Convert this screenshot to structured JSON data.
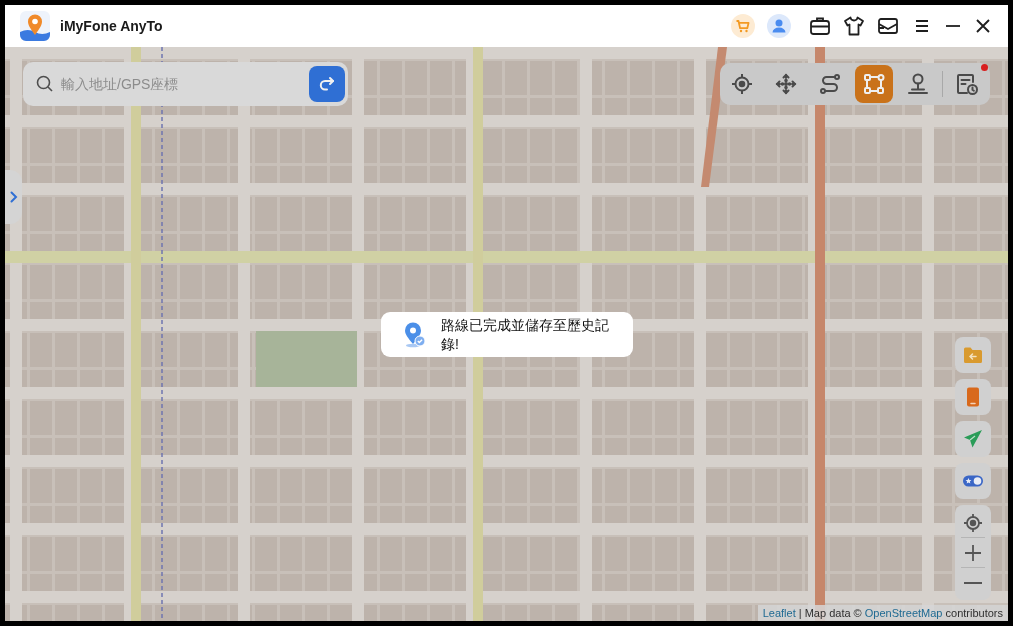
{
  "window": {
    "title": "iMyFone AnyTo"
  },
  "search": {
    "placeholder": "輸入地址/GPS座標"
  },
  "mode_toolbar": [
    {
      "selected": false,
      "badge": false
    },
    {
      "selected": false,
      "badge": false
    },
    {
      "selected": false,
      "badge": false
    },
    {
      "selected": true,
      "badge": false
    },
    {
      "selected": false,
      "badge": false
    },
    {
      "selected": false,
      "badge": true
    }
  ],
  "toast": {
    "message": "路線已完成並儲存至歷史記錄!"
  },
  "attribution": [
    {
      "kind": "link",
      "text": "Leaflet"
    },
    {
      "kind": "text",
      "text": "| Map data ©"
    },
    {
      "kind": "link",
      "text": "OpenStreetMap"
    },
    {
      "kind": "text",
      "text": "contributors"
    }
  ]
}
